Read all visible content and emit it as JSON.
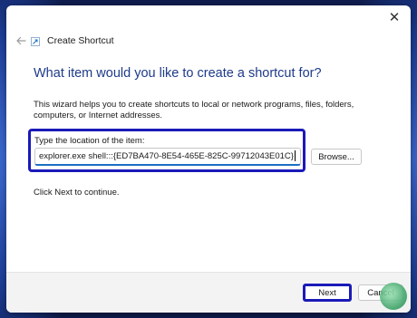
{
  "window": {
    "title": "Create Shortcut",
    "close_glyph": "✕"
  },
  "wizard": {
    "heading": "What item would you like to create a shortcut for?",
    "description": "This wizard helps you to create shortcuts to local or network programs, files, folders, computers, or Internet addresses.",
    "location_label": "Type the location of the item:",
    "location_value": "explorer.exe shell:::{ED7BA470-8E54-465E-825C-99712043E01C}",
    "browse_label": "Browse...",
    "continue_text": "Click Next to continue."
  },
  "footer": {
    "next_label": "Next",
    "cancel_label": "Cancel"
  },
  "icons": {
    "back": "back-arrow-icon",
    "app": "shortcut-icon",
    "close": "close-icon",
    "watermark": "watermark-logo"
  },
  "colors": {
    "heading": "#1e3a8a",
    "highlight": "#1a1ab8",
    "input_focus": "#1b6fc2"
  }
}
